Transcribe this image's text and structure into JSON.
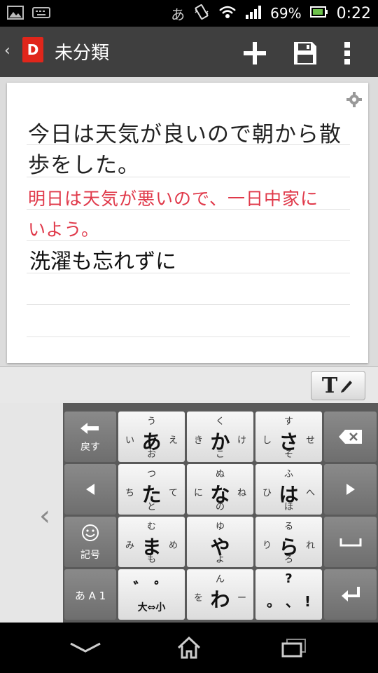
{
  "status_bar": {
    "ime": "あ",
    "battery": "69%",
    "time": "0:22"
  },
  "action_bar": {
    "back_glyph": "‹",
    "logo_letter": "D",
    "title": "未分類"
  },
  "note": {
    "handwriting_lines": [
      {
        "text": "今日は天気が良いので朝から散",
        "color": "#222222"
      },
      {
        "text": "歩をした。",
        "color": "#222222"
      },
      {
        "text": "明日は天気が悪いので、一日中家に",
        "color": "#e0394a"
      },
      {
        "text": "いよう。",
        "color": "#e0394a"
      }
    ],
    "typed_line": "洗濯も忘れずに"
  },
  "toolstrip": {
    "text_tool": "T"
  },
  "keyboard": {
    "back_label": "戻す",
    "kigou_label": "記号",
    "mode_label": "あ A 1",
    "rows": [
      [
        {
          "main": "あ",
          "up": "う",
          "down": "お",
          "left": "い",
          "right": "え"
        },
        {
          "main": "か",
          "up": "く",
          "down": "こ",
          "left": "き",
          "right": "け"
        },
        {
          "main": "さ",
          "up": "す",
          "down": "そ",
          "left": "し",
          "right": "せ"
        }
      ],
      [
        {
          "main": "た",
          "up": "つ",
          "down": "と",
          "left": "ち",
          "right": "て"
        },
        {
          "main": "な",
          "up": "ぬ",
          "down": "の",
          "left": "に",
          "right": "ね"
        },
        {
          "main": "は",
          "up": "ふ",
          "down": "ほ",
          "left": "ひ",
          "right": "へ"
        }
      ],
      [
        {
          "main": "ま",
          "up": "む",
          "down": "も",
          "left": "み",
          "right": "め"
        },
        {
          "main": "や",
          "up": "ゆ",
          "down": "よ",
          "left": "",
          "right": ""
        },
        {
          "main": "ら",
          "up": "る",
          "down": "ろ",
          "left": "り",
          "right": "れ"
        }
      ],
      [
        {
          "main": "゛ ゜",
          "up": "",
          "down": "大⇔小",
          "left": "",
          "right": ""
        },
        {
          "main": "わ",
          "up": "ん",
          "down": "",
          "left": "を",
          "right": "ー"
        },
        {
          "main": "。 、 !",
          "up": "?",
          "down": "",
          "left": "",
          "right": ""
        }
      ]
    ]
  }
}
